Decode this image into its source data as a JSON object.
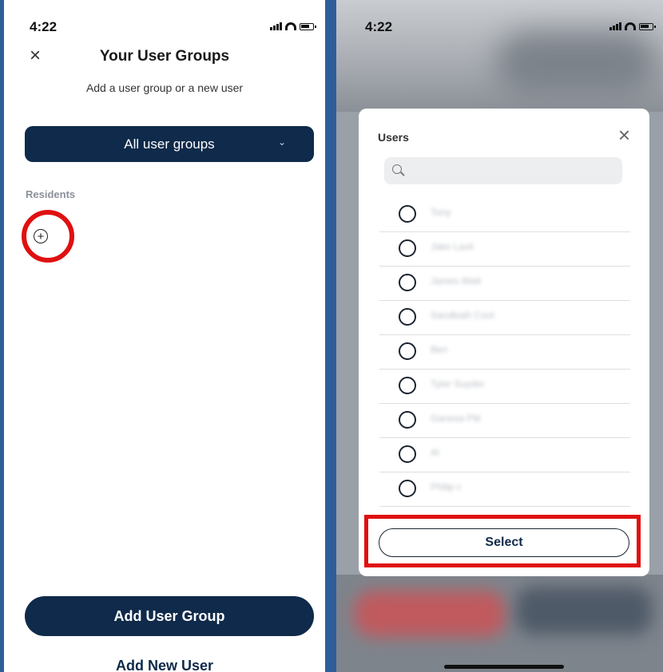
{
  "left_screen": {
    "status_time": "4:22",
    "close_glyph": "×",
    "title": "Your User Groups",
    "subtitle": "Add a user group or a new user",
    "dropdown": {
      "selected": "All user groups",
      "chevron": "⌄"
    },
    "section_label": "Residents",
    "add_icon": "plus-circle-icon",
    "add_glyph": "+",
    "primary_button": "Add User Group",
    "secondary_button": "Add New User"
  },
  "right_screen": {
    "status_time": "4:22",
    "modal": {
      "title": "Users",
      "close_glyph": "×",
      "search": {
        "placeholder": "",
        "value": ""
      },
      "users": [
        {
          "name": "Tony"
        },
        {
          "name": "Jake Lavil"
        },
        {
          "name": "James Watt"
        },
        {
          "name": "Sandbath Cool"
        },
        {
          "name": "Ben"
        },
        {
          "name": "Tyler Suyder"
        },
        {
          "name": "Ganesa Pitt"
        },
        {
          "name": "Al"
        },
        {
          "name": "Philip c"
        }
      ],
      "select_button": "Select"
    }
  },
  "colors": {
    "navy": "#0f2a4a",
    "highlight_red": "#e01010",
    "frame_blue": "#2f5d9a"
  }
}
